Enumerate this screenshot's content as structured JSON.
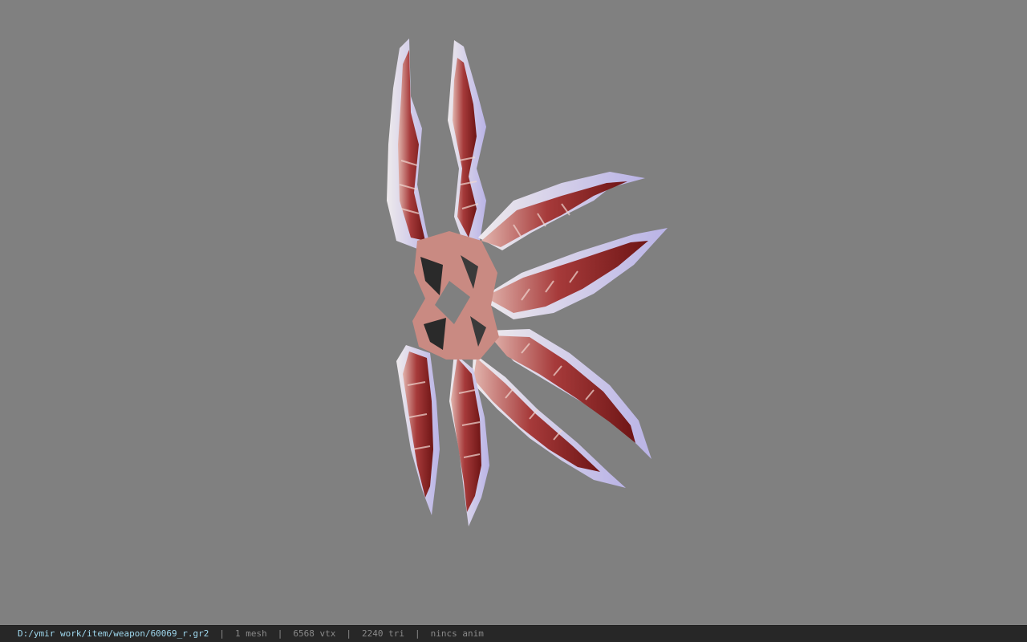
{
  "viewer": {
    "background_color": "#808080",
    "model_icon": "weapon-mesh-icon",
    "model_colors": {
      "blade_edge": "#d9d4d6",
      "blade_glow": "#b9b3e6",
      "body_dark": "#6e1515",
      "body_mid": "#a63a3a",
      "body_light": "#e2b5ae",
      "detail_dark": "#2a2a2a"
    }
  },
  "statusbar": {
    "file_path": "D:/ymir work/item/weapon/60069_r.gr2",
    "mesh_count": "1 mesh",
    "vertex_count": "6568 vtx",
    "triangle_count": "2240 tri",
    "anim_status": "nincs anim",
    "separator": "|",
    "background_color": "#272727",
    "path_color": "#9fd8ee"
  }
}
